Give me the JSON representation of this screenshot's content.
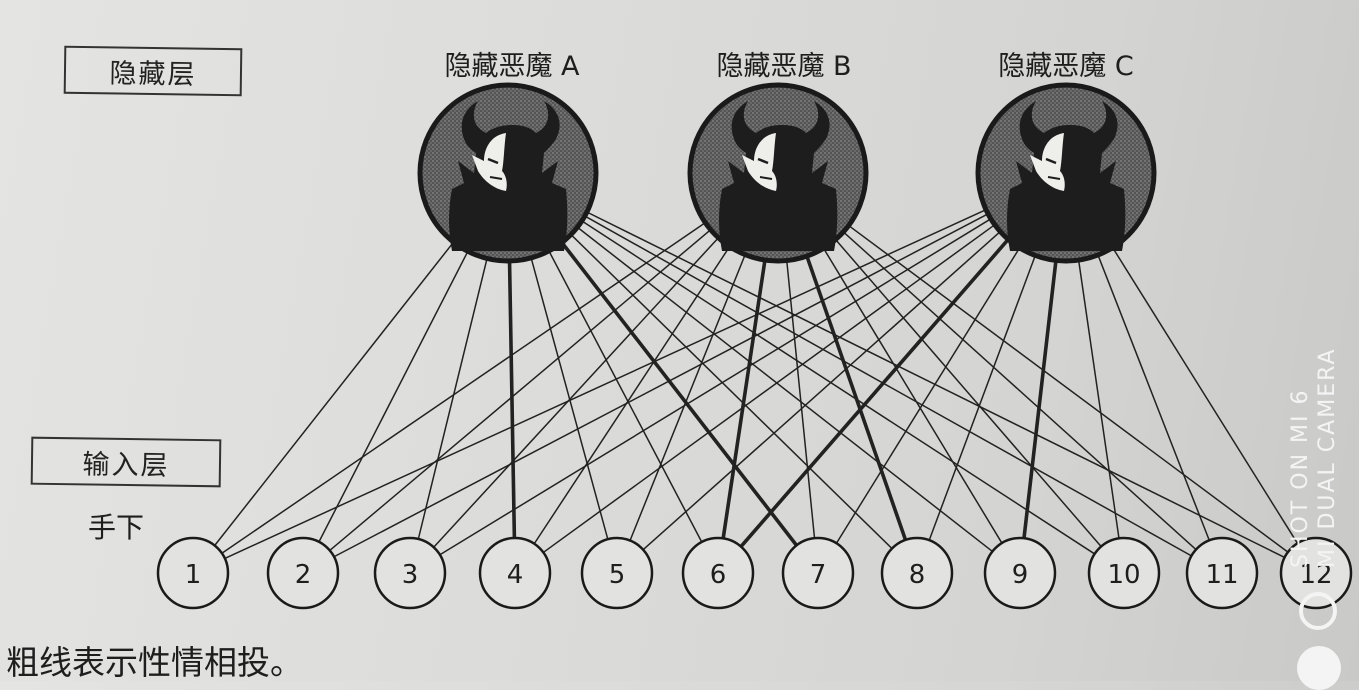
{
  "hidden_layer": {
    "label": "隐藏层",
    "demons": [
      {
        "id": "A",
        "label": "隐藏恶魔 A"
      },
      {
        "id": "B",
        "label": "隐藏恶魔 B"
      },
      {
        "id": "C",
        "label": "隐藏恶魔 C"
      }
    ]
  },
  "input_layer": {
    "label": "输入层",
    "sublabel": "手下",
    "nodes": [
      "1",
      "2",
      "3",
      "4",
      "5",
      "6",
      "7",
      "8",
      "9",
      "10",
      "11",
      "12"
    ]
  },
  "connections": {
    "style": "fully-connected",
    "thick_edges": [
      [
        "A",
        "4"
      ],
      [
        "A",
        "7"
      ],
      [
        "B",
        "6"
      ],
      [
        "B",
        "8"
      ],
      [
        "C",
        "6"
      ],
      [
        "C",
        "9"
      ]
    ]
  },
  "caption": "粗线表示性情相投。",
  "watermark": {
    "line1": "SHOT ON MI 6",
    "line2": "MI DUAL CAMERA"
  },
  "icons": {
    "demon": "demon-icon",
    "camera": "camera-shutter-icon"
  },
  "colors": {
    "paper": "#dcdcda",
    "ink": "#1e1e1e",
    "circle_fill": "#3a3a3a"
  }
}
